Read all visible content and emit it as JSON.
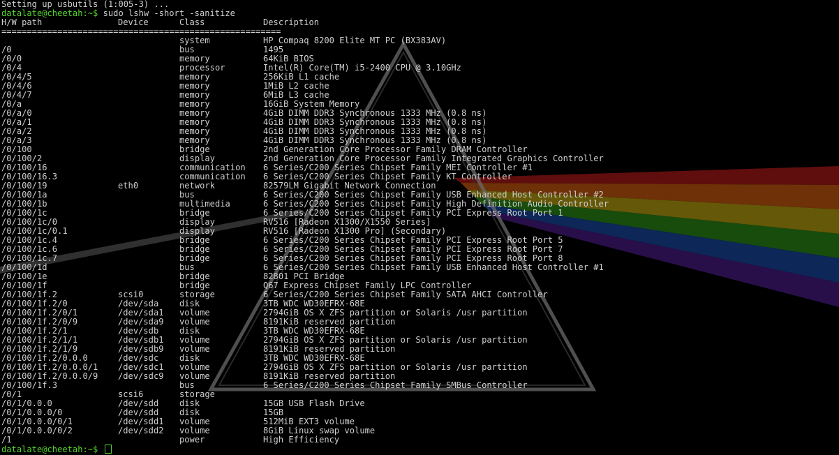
{
  "terminal": {
    "pre_lines": [
      "Setting up usbutils (1:005-3) ..."
    ],
    "prompt": "datalate@cheetah:~$",
    "command": "sudo lshw -short -sanitize",
    "headers": [
      "H/W path",
      "Device",
      "Class",
      "Description"
    ],
    "separator": "=======================================================",
    "rows": [
      [
        "",
        "",
        "system",
        "HP Compaq 8200 Elite MT PC (BX383AV)"
      ],
      [
        "/0",
        "",
        "bus",
        "1495"
      ],
      [
        "/0/0",
        "",
        "memory",
        "64KiB BIOS"
      ],
      [
        "/0/4",
        "",
        "processor",
        "Intel(R) Core(TM) i5-2400 CPU @ 3.10GHz"
      ],
      [
        "/0/4/5",
        "",
        "memory",
        "256KiB L1 cache"
      ],
      [
        "/0/4/6",
        "",
        "memory",
        "1MiB L2 cache"
      ],
      [
        "/0/4/7",
        "",
        "memory",
        "6MiB L3 cache"
      ],
      [
        "/0/a",
        "",
        "memory",
        "16GiB System Memory"
      ],
      [
        "/0/a/0",
        "",
        "memory",
        "4GiB DIMM DDR3 Synchronous 1333 MHz (0.8 ns)"
      ],
      [
        "/0/a/1",
        "",
        "memory",
        "4GiB DIMM DDR3 Synchronous 1333 MHz (0.8 ns)"
      ],
      [
        "/0/a/2",
        "",
        "memory",
        "4GiB DIMM DDR3 Synchronous 1333 MHz (0.8 ns)"
      ],
      [
        "/0/a/3",
        "",
        "memory",
        "4GiB DIMM DDR3 Synchronous 1333 MHz (0.8 ns)"
      ],
      [
        "/0/100",
        "",
        "bridge",
        "2nd Generation Core Processor Family DRAM Controller"
      ],
      [
        "/0/100/2",
        "",
        "display",
        "2nd Generation Core Processor Family Integrated Graphics Controller"
      ],
      [
        "/0/100/16",
        "",
        "communication",
        "6 Series/C200 Series Chipset Family MEI Controller #1"
      ],
      [
        "/0/100/16.3",
        "",
        "communication",
        "6 Series/C200 Series Chipset Family KT Controller"
      ],
      [
        "/0/100/19",
        "eth0",
        "network",
        "82579LM Gigabit Network Connection"
      ],
      [
        "/0/100/1a",
        "",
        "bus",
        "6 Series/C200 Series Chipset Family USB Enhanced Host Controller #2"
      ],
      [
        "/0/100/1b",
        "",
        "multimedia",
        "6 Series/C200 Series Chipset Family High Definition Audio Controller"
      ],
      [
        "/0/100/1c",
        "",
        "bridge",
        "6 Series/C200 Series Chipset Family PCI Express Root Port 1"
      ],
      [
        "/0/100/1c/0",
        "",
        "display",
        "RV516 [Radeon X1300/X1550 Series]"
      ],
      [
        "/0/100/1c/0.1",
        "",
        "display",
        "RV516 [Radeon X1300 Pro] (Secondary)"
      ],
      [
        "/0/100/1c.4",
        "",
        "bridge",
        "6 Series/C200 Series Chipset Family PCI Express Root Port 5"
      ],
      [
        "/0/100/1c.6",
        "",
        "bridge",
        "6 Series/C200 Series Chipset Family PCI Express Root Port 7"
      ],
      [
        "/0/100/1c.7",
        "",
        "bridge",
        "6 Series/C200 Series Chipset Family PCI Express Root Port 8"
      ],
      [
        "/0/100/1d",
        "",
        "bus",
        "6 Series/C200 Series Chipset Family USB Enhanced Host Controller #1"
      ],
      [
        "/0/100/1e",
        "",
        "bridge",
        "82801 PCI Bridge"
      ],
      [
        "/0/100/1f",
        "",
        "bridge",
        "Q67 Express Chipset Family LPC Controller"
      ],
      [
        "/0/100/1f.2",
        "scsi0",
        "storage",
        "6 Series/C200 Series Chipset Family SATA AHCI Controller"
      ],
      [
        "/0/100/1f.2/0",
        "/dev/sda",
        "disk",
        "3TB WDC WD30EFRX-68E"
      ],
      [
        "/0/100/1f.2/0/1",
        "/dev/sda1",
        "volume",
        "2794GiB OS X ZFS partition or Solaris /usr partition"
      ],
      [
        "/0/100/1f.2/0/9",
        "/dev/sda9",
        "volume",
        "8191KiB reserved partition"
      ],
      [
        "/0/100/1f.2/1",
        "/dev/sdb",
        "disk",
        "3TB WDC WD30EFRX-68E"
      ],
      [
        "/0/100/1f.2/1/1",
        "/dev/sdb1",
        "volume",
        "2794GiB OS X ZFS partition or Solaris /usr partition"
      ],
      [
        "/0/100/1f.2/1/9",
        "/dev/sdb9",
        "volume",
        "8191KiB reserved partition"
      ],
      [
        "/0/100/1f.2/0.0.0",
        "/dev/sdc",
        "disk",
        "3TB WDC WD30EFRX-68E"
      ],
      [
        "/0/100/1f.2/0.0.0/1",
        "/dev/sdc1",
        "volume",
        "2794GiB OS X ZFS partition or Solaris /usr partition"
      ],
      [
        "/0/100/1f.2/0.0.0/9",
        "/dev/sdc9",
        "volume",
        "8191KiB reserved partition"
      ],
      [
        "/0/100/1f.3",
        "",
        "bus",
        "6 Series/C200 Series Chipset Family SMBus Controller"
      ],
      [
        "/0/1",
        "scsi6",
        "storage",
        ""
      ],
      [
        "/0/1/0.0.0",
        "/dev/sdd",
        "disk",
        "15GB USB Flash Drive"
      ],
      [
        "/0/1/0.0.0/0",
        "/dev/sdd",
        "disk",
        "15GB"
      ],
      [
        "/0/1/0.0.0/0/1",
        "/dev/sdd1",
        "volume",
        "512MiB EXT3 volume"
      ],
      [
        "/0/1/0.0.0/0/2",
        "/dev/sdd2",
        "volume",
        "8GiB Linux swap volume"
      ],
      [
        "/1",
        "",
        "power",
        "High Efficiency"
      ]
    ],
    "final_prompt": "datalate@cheetah:~$"
  },
  "colors": {
    "prompt": "#55d62c",
    "text": "#cfcfcf",
    "background": "#000000"
  },
  "background_art": "prism-rainbow-wallpaper"
}
